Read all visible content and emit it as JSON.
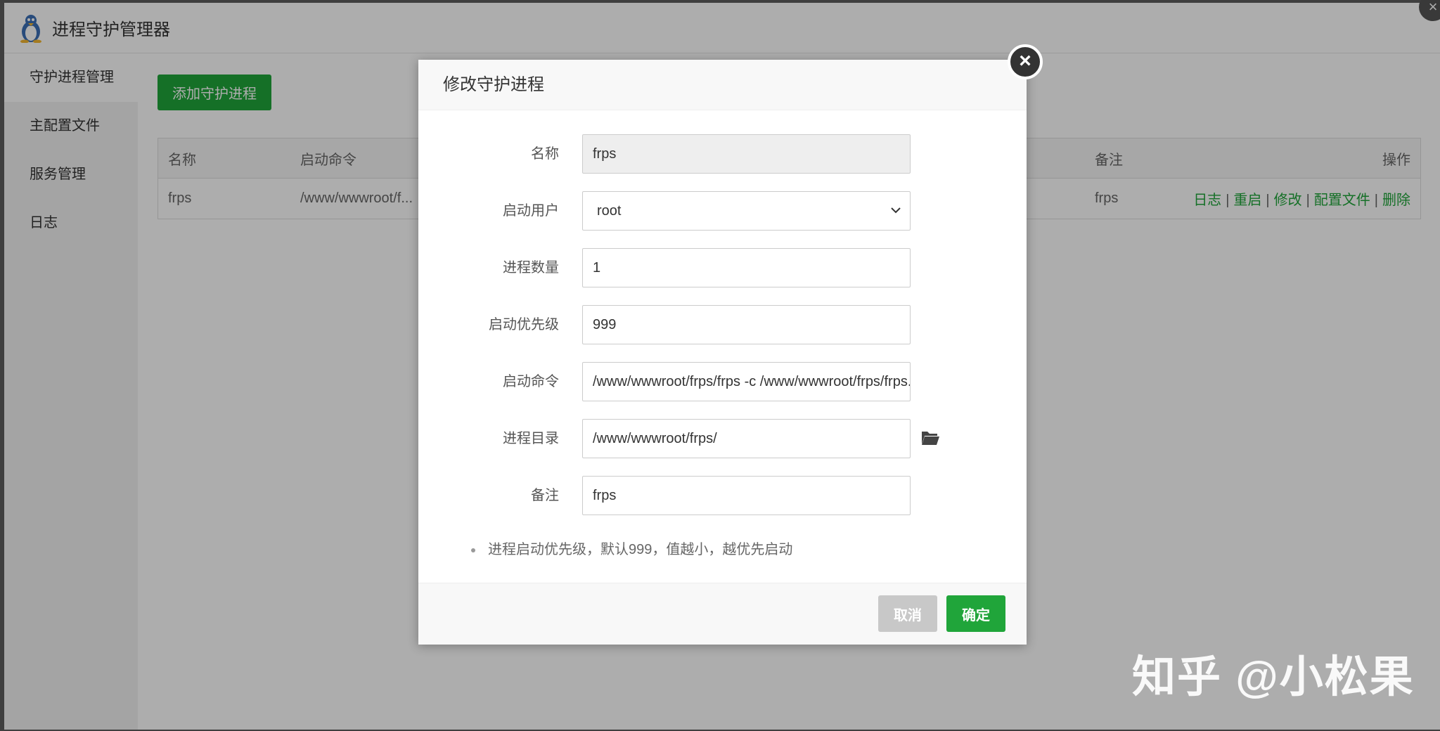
{
  "app": {
    "title": "进程守护管理器"
  },
  "sidebar": {
    "items": [
      {
        "label": "守护进程管理"
      },
      {
        "label": "主配置文件"
      },
      {
        "label": "服务管理"
      },
      {
        "label": "日志"
      }
    ]
  },
  "main": {
    "add_button_label": "添加守护进程",
    "table": {
      "headers": {
        "name": "名称",
        "cmd": "启动命令",
        "note": "备注",
        "op": "操作"
      },
      "rows": [
        {
          "name": "frps",
          "cmd": "/www/wwwroot/f...",
          "note": "frps"
        }
      ],
      "actions": [
        "日志",
        "重启",
        "修改",
        "配置文件",
        "删除"
      ],
      "action_separator": "|"
    }
  },
  "modal": {
    "title": "修改守护进程",
    "close_symbol": "×",
    "fields": {
      "name": {
        "label": "名称",
        "value": "frps"
      },
      "user": {
        "label": "启动用户",
        "value": "root"
      },
      "count": {
        "label": "进程数量",
        "value": "1"
      },
      "priority": {
        "label": "启动优先级",
        "value": "999"
      },
      "command": {
        "label": "启动命令",
        "value": "/www/wwwroot/frps/frps -c /www/wwwroot/frps/frps.ini"
      },
      "dir": {
        "label": "进程目录",
        "value": "/www/wwwroot/frps/"
      },
      "note": {
        "label": "备注",
        "value": "frps"
      }
    },
    "tip": "进程启动优先级，默认999，值越小，越优先启动",
    "cancel_label": "取消",
    "ok_label": "确定"
  },
  "watermark": "知乎 @小松果",
  "colors": {
    "accent": "#20a53a",
    "cancel": "#c8c8c8"
  }
}
